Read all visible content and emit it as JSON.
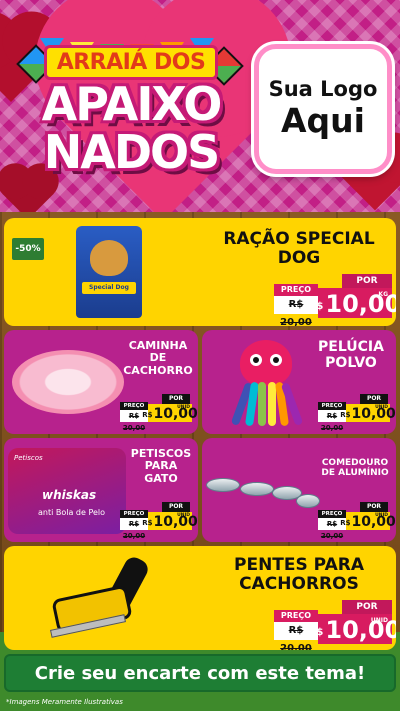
{
  "header": {
    "title_top": "ARRAIÁ DOS",
    "title_line1": "APAIXO",
    "title_line2": "NADOS",
    "logo_line1": "Sua Logo",
    "logo_line2": "Aqui"
  },
  "products": [
    {
      "id": "racao",
      "name_line1": "RAÇÃO SPECIAL",
      "name_line2": "DOG",
      "discount": "-50%",
      "por": "POR",
      "preco": "PREÇO",
      "old_price": "R$ 20,00",
      "currency": "R$",
      "price": "10,00",
      "unit": "KG",
      "pack_label": "Special Dog"
    },
    {
      "id": "caminha",
      "name_line1": "CAMINHA",
      "name_line2": "DE",
      "name_line3": "CACHORRO",
      "por": "POR",
      "preco": "PREÇO",
      "old_price": "R$ 20,00",
      "currency": "R$",
      "price": "10,00",
      "unit": "UNID"
    },
    {
      "id": "pelucia",
      "name_line1": "PELÚCIA",
      "name_line2": "POLVO",
      "por": "POR",
      "preco": "PREÇO",
      "old_price": "R$ 20,00",
      "currency": "R$",
      "price": "10,00",
      "unit": "UNID"
    },
    {
      "id": "petiscos",
      "name_line1": "PETISCOS",
      "name_line2": "PARA",
      "name_line3": "GATO",
      "por": "POR",
      "preco": "PREÇO",
      "old_price": "R$ 20,00",
      "currency": "R$",
      "price": "10,00",
      "unit": "UNID",
      "pack_top": "Petiscos",
      "pack_brand": "whiskas",
      "pack_sub": "anti Bola de Pelo"
    },
    {
      "id": "comedouro",
      "name_line1": "COMEDOURO",
      "name_line2": "DE ALUMÍNIO",
      "por": "POR",
      "preco": "PREÇO",
      "old_price": "R$ 20,00",
      "currency": "R$",
      "price": "10,00",
      "unit": "UNID"
    },
    {
      "id": "pentes",
      "name_line1": "PENTES PARA",
      "name_line2": "CACHORROS",
      "por": "POR",
      "preco": "PREÇO",
      "old_price": "R$ 20,00",
      "currency": "R$",
      "price": "10,00",
      "unit": "UNID"
    }
  ],
  "cta": {
    "label": "Crie seu encarte com este tema!"
  },
  "footer": {
    "disclaimer": "*Imagens Meramente Ilustrativas"
  },
  "colors": {
    "header_bg": "#c21f86",
    "yellow_card": "#ffd400",
    "purple_card": "#b7228d",
    "price_pink": "#d81b60",
    "cta_green": "#1e7e34"
  }
}
